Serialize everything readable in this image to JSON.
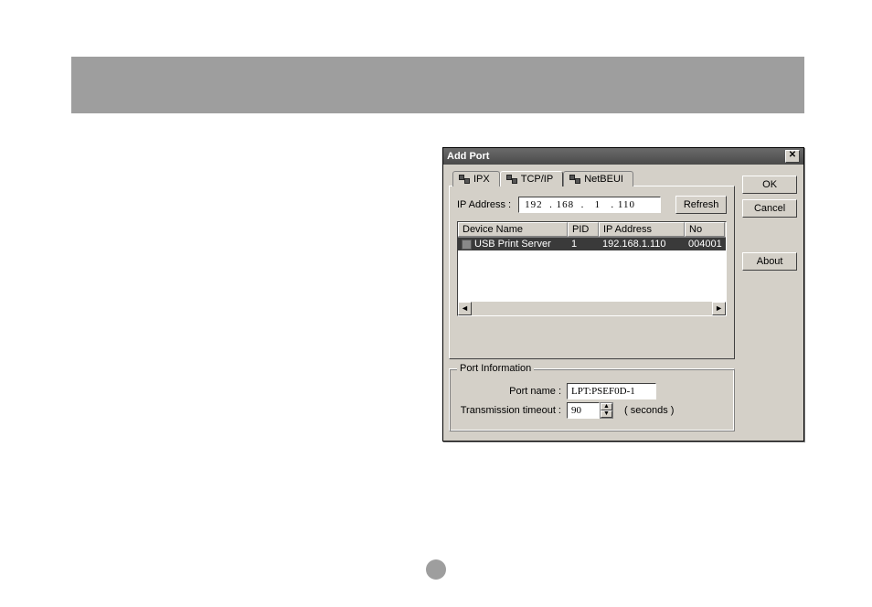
{
  "dialog": {
    "title": "Add Port",
    "tabs": [
      {
        "label": "IPX"
      },
      {
        "label": "TCP/IP"
      },
      {
        "label": "NetBEUI"
      }
    ],
    "buttons": {
      "ok": "OK",
      "cancel": "Cancel",
      "about": "About",
      "refresh": "Refresh"
    },
    "ip_label": "IP Address :",
    "ip_value": "192  . 168  .   1   . 110",
    "list": {
      "headers": {
        "name": "Device Name",
        "pid": "PID",
        "ip": "IP Address",
        "no": "No"
      },
      "row": {
        "name": "USB Print Server",
        "pid": "1",
        "ip": "192.168.1.110",
        "no": "004001"
      }
    },
    "portinfo": {
      "legend": "Port Information",
      "portname_label": "Port name :",
      "portname_value": "LPT:PSEF0D-1",
      "timeout_label": "Transmission timeout :",
      "timeout_value": "90",
      "seconds": "( seconds )"
    }
  }
}
